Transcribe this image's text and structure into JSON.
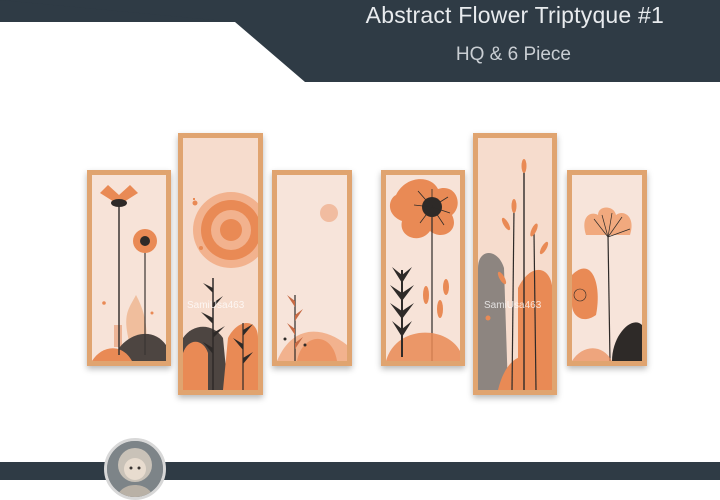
{
  "header": {
    "title": "Abstract Flower Triptyque #1",
    "subtitle": "HQ & 6 Piece"
  },
  "watermarks": [
    "SamiUsa463",
    "SamiUsa463"
  ],
  "colors": {
    "header_bg": "#2f3b45",
    "frame": "#e0a470",
    "canvas": "#f6ddd0",
    "accent_orange": "#e98a55",
    "dark_gray": "#4a4542"
  },
  "panels": [
    {
      "name": "panel-1-tall-narrow-flowers"
    },
    {
      "name": "panel-2-sun-and-foliage"
    },
    {
      "name": "panel-3-small-sun-and-plants"
    },
    {
      "name": "panel-4-big-flower-and-leaves"
    },
    {
      "name": "panel-5-grass-stems"
    },
    {
      "name": "panel-6-round-flower"
    }
  ],
  "avatar": {
    "icon": "doll-avatar-icon"
  }
}
